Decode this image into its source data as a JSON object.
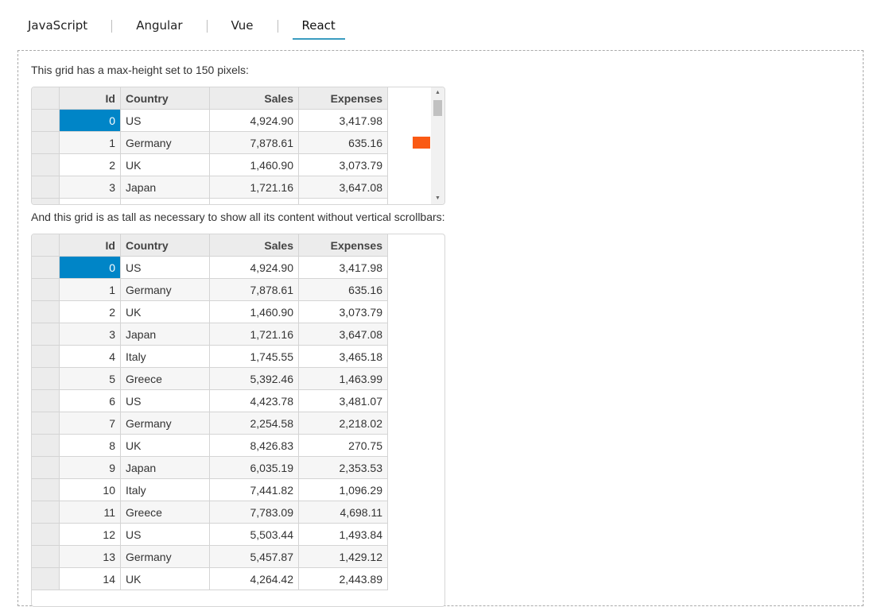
{
  "tabs": [
    {
      "label": "JavaScript",
      "active": false
    },
    {
      "label": "Angular",
      "active": false
    },
    {
      "label": "Vue",
      "active": false
    },
    {
      "label": "React",
      "active": true
    }
  ],
  "grid1_caption": "This grid has a max-height set to 150 pixels:",
  "grid2_caption": "And this grid is as tall as necessary to show all its content without vertical scrollbars:",
  "columns": [
    "Id",
    "Country",
    "Sales",
    "Expenses"
  ],
  "rows": [
    {
      "id": "0",
      "country": "US",
      "sales": "4,924.90",
      "expenses": "3,417.98"
    },
    {
      "id": "1",
      "country": "Germany",
      "sales": "7,878.61",
      "expenses": "635.16"
    },
    {
      "id": "2",
      "country": "UK",
      "sales": "1,460.90",
      "expenses": "3,073.79"
    },
    {
      "id": "3",
      "country": "Japan",
      "sales": "1,721.16",
      "expenses": "3,647.08"
    },
    {
      "id": "4",
      "country": "Italy",
      "sales": "1,745.55",
      "expenses": "3,465.18"
    },
    {
      "id": "5",
      "country": "Greece",
      "sales": "5,392.46",
      "expenses": "1,463.99"
    },
    {
      "id": "6",
      "country": "US",
      "sales": "4,423.78",
      "expenses": "3,481.07"
    },
    {
      "id": "7",
      "country": "Germany",
      "sales": "2,254.58",
      "expenses": "2,218.02"
    },
    {
      "id": "8",
      "country": "UK",
      "sales": "8,426.83",
      "expenses": "270.75"
    },
    {
      "id": "9",
      "country": "Japan",
      "sales": "6,035.19",
      "expenses": "2,353.53"
    },
    {
      "id": "10",
      "country": "Italy",
      "sales": "7,441.82",
      "expenses": "1,096.29"
    },
    {
      "id": "11",
      "country": "Greece",
      "sales": "7,783.09",
      "expenses": "4,698.11"
    },
    {
      "id": "12",
      "country": "US",
      "sales": "5,503.44",
      "expenses": "1,493.84"
    },
    {
      "id": "13",
      "country": "Germany",
      "sales": "5,457.87",
      "expenses": "1,429.12"
    },
    {
      "id": "14",
      "country": "UK",
      "sales": "4,264.42",
      "expenses": "2,443.89"
    }
  ],
  "grid1_visible_rows": 5,
  "colors": {
    "accent": "#3a9cc0",
    "selection": "#0085c7",
    "marker": "#fa5a14"
  },
  "icons": {
    "scroll_up": "arrow-up-icon",
    "scroll_down": "arrow-down-icon"
  }
}
